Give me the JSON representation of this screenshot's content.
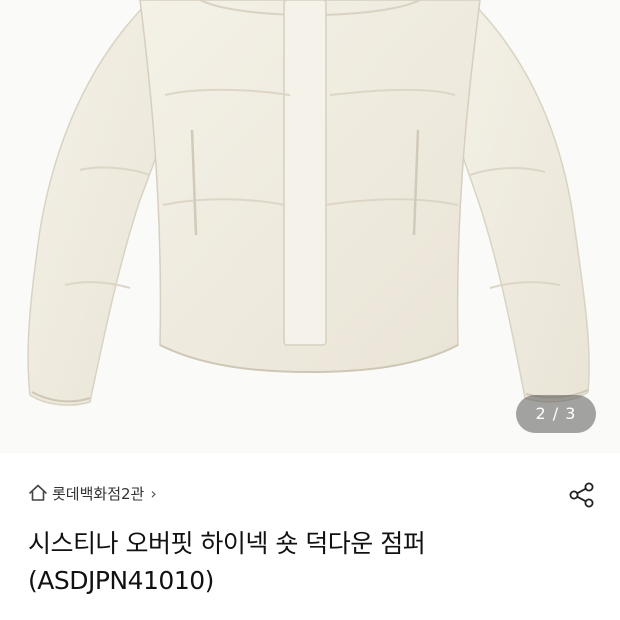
{
  "image_counter": {
    "current": "2",
    "total": "3",
    "separator": "/"
  },
  "store": {
    "name": "롯데백화점2관"
  },
  "product": {
    "title_line1": "시스티나 오버핏 하이넥 숏 덕다운 점퍼",
    "title_line2": "(ASDJPN41010)"
  },
  "colors": {
    "jacket": "#f1ede1",
    "background": "#fafaf8",
    "counter_bg": "#5a5a5a"
  },
  "icons": {
    "home": "home-icon",
    "share": "share-icon",
    "chevron": "chevron-right-icon"
  }
}
